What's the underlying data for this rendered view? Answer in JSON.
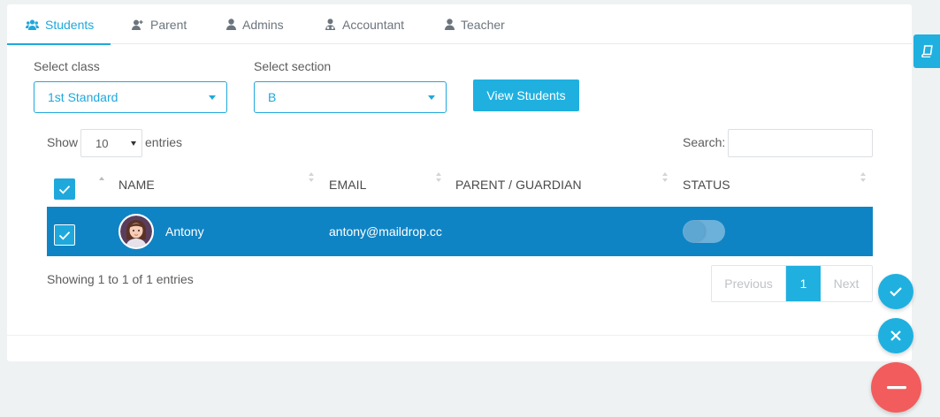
{
  "tabs": [
    {
      "label": "Students",
      "icon": "users-icon",
      "active": true
    },
    {
      "label": "Parent",
      "icon": "user-plus-icon",
      "active": false
    },
    {
      "label": "Admins",
      "icon": "user-icon",
      "active": false
    },
    {
      "label": "Accountant",
      "icon": "user-tie-icon",
      "active": false
    },
    {
      "label": "Teacher",
      "icon": "user-icon",
      "active": false
    }
  ],
  "filters": {
    "class_label": "Select class",
    "class_value": "1st Standard",
    "section_label": "Select section",
    "section_value": "B",
    "view_button": "View Students"
  },
  "table_controls": {
    "show_label": "Show",
    "length_value": "10",
    "entries_label": "entries",
    "search_label": "Search:",
    "search_value": ""
  },
  "table": {
    "columns": [
      "NAME",
      "EMAIL",
      "PARENT / GUARDIAN",
      "STATUS"
    ],
    "rows": [
      {
        "name": "Antony",
        "email": "antony@maildrop.cc",
        "parent": "",
        "status_on": false,
        "selected": true
      }
    ]
  },
  "footer": {
    "info": "Showing 1 to 1 of 1 entries",
    "previous": "Previous",
    "page": "1",
    "next": "Next"
  },
  "colors": {
    "accent": "#1fb0e0",
    "row_highlight": "#0f84c4",
    "danger": "#f25c5c"
  },
  "floating_actions": [
    "check-icon",
    "close-icon",
    "minus-icon"
  ],
  "side_tab_icon": "book-icon"
}
